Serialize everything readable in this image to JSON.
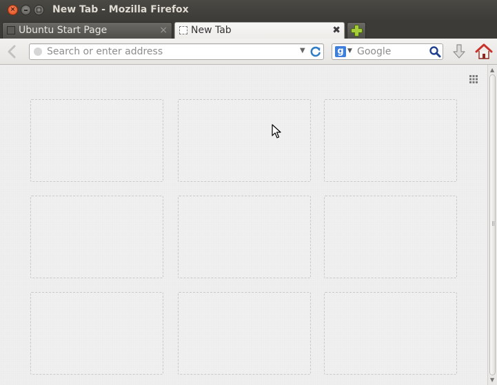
{
  "window": {
    "title": "New Tab - Mozilla Firefox",
    "close_glyph": "×",
    "min_label": "",
    "max_label": ""
  },
  "tabs": [
    {
      "label": "Ubuntu Start Page",
      "active": false,
      "close_glyph": "×"
    },
    {
      "label": "New Tab",
      "active": true,
      "close_glyph": "✖"
    }
  ],
  "navbar": {
    "url_placeholder": "Search or enter address",
    "url_value": "",
    "url_dropmarker": "▼",
    "search_engine": "Google",
    "search_engine_logo": "g",
    "search_dropmarker": "▼",
    "search_placeholder": "Google",
    "search_value": ""
  },
  "icons": {
    "back": "back-arrow-icon",
    "reload": "reload-icon",
    "search": "magnifier-icon",
    "download": "download-arrow-icon",
    "home": "home-icon",
    "grid": "grid-icon",
    "new_tab": "plus-icon"
  },
  "colors": {
    "titlebar_bg": "#3c3b37",
    "close_orange": "#df4a16",
    "plus_green": "#a7cc3a",
    "home_red": "#c8322a",
    "reload_blue": "#2f7dc6",
    "content_bg": "#efefef"
  },
  "newtab_page": {
    "tiles": [
      "",
      "",
      "",
      "",
      "",
      "",
      "",
      "",
      ""
    ]
  }
}
